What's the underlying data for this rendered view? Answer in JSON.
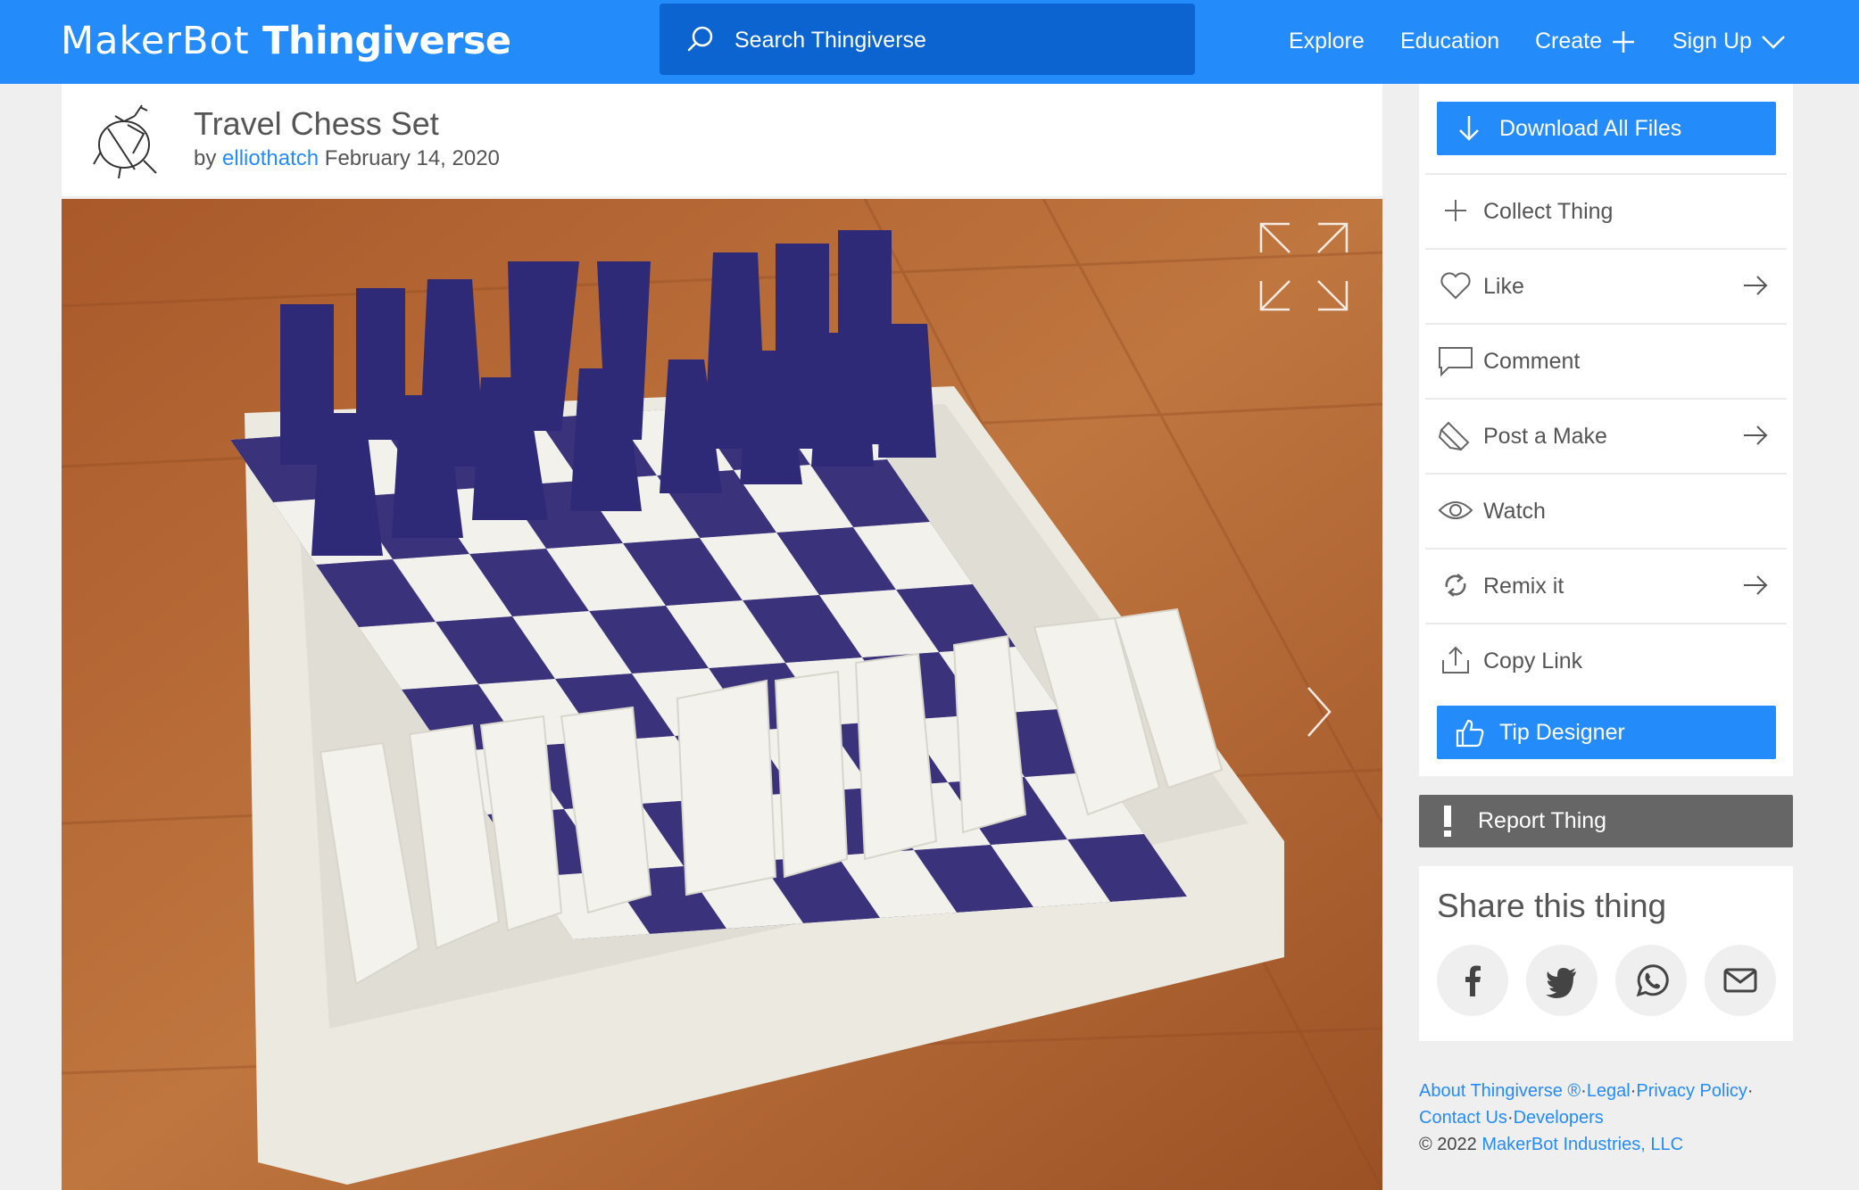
{
  "header": {
    "logo_maker": "MakerBot",
    "logo_thingiverse": "Thingiverse",
    "search_placeholder": "Search Thingiverse",
    "nav": {
      "explore": "Explore",
      "education": "Education",
      "create": "Create",
      "signup": "Sign Up"
    }
  },
  "thing": {
    "title": "Travel Chess Set",
    "by": "by",
    "author": "elliothatch",
    "date": "February 14, 2020"
  },
  "sidebar": {
    "download": "Download All Files",
    "actions": [
      {
        "label": "Collect Thing",
        "icon": "plus-icon"
      },
      {
        "label": "Like",
        "icon": "heart-icon"
      },
      {
        "label": "Comment",
        "icon": "comment-icon"
      },
      {
        "label": "Post a Make",
        "icon": "post-make-icon"
      },
      {
        "label": "Watch",
        "icon": "eye-icon"
      },
      {
        "label": "Remix it",
        "icon": "remix-icon"
      },
      {
        "label": "Copy Link",
        "icon": "share-upload-icon"
      }
    ],
    "tip": "Tip Designer",
    "report": "Report Thing"
  },
  "share": {
    "title": "Share this thing",
    "networks": [
      "facebook",
      "twitter",
      "whatsapp",
      "email"
    ]
  },
  "footer": {
    "about": "About Thingiverse ®",
    "legal": "Legal",
    "privacy": "Privacy Policy",
    "contact": "Contact Us",
    "developers": "Developers",
    "copyright": "©  2022",
    "company": "MakerBot Industries, LLC"
  },
  "colors": {
    "brand": "#248bfb",
    "search_bg": "#0b64cf",
    "report_bg": "#666666",
    "page_bg": "#efefef"
  }
}
